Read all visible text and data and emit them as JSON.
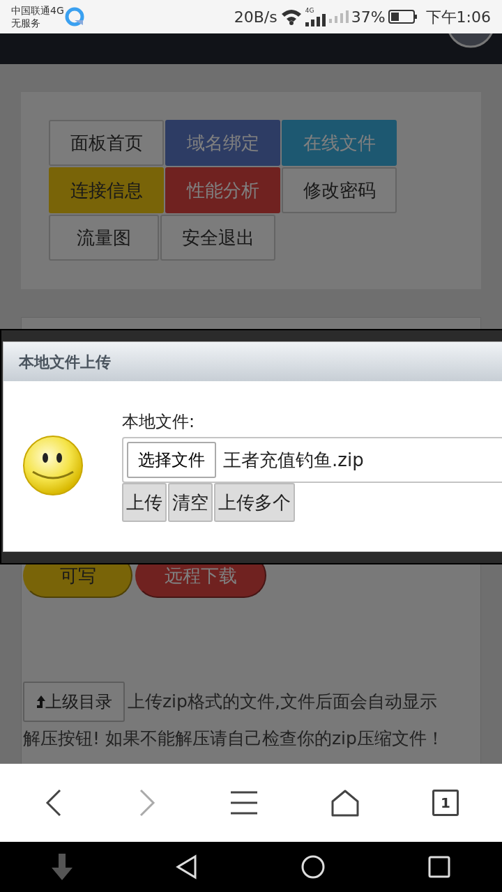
{
  "status_bar": {
    "carrier": "中国联通4G",
    "service": "无服务",
    "speed": "20B/s",
    "network": "4G",
    "battery": "37%",
    "time": "下午1:06"
  },
  "menu_buttons": [
    {
      "label": "面板首页",
      "kind": "default"
    },
    {
      "label": "域名绑定",
      "kind": "primary"
    },
    {
      "label": "在线文件",
      "kind": "info"
    },
    {
      "label": "连接信息",
      "kind": "warning"
    },
    {
      "label": "性能分析",
      "kind": "danger"
    },
    {
      "label": "修改密码",
      "kind": "default"
    },
    {
      "label": "流量图",
      "kind": "default"
    },
    {
      "label": "安全退出",
      "kind": "default"
    }
  ],
  "dialog": {
    "title": "本地文件上传",
    "field_label": "本地文件:",
    "choose_button": "选择文件",
    "file_name": "王者充值钓鱼.zip",
    "buttons": [
      "上传",
      "清空",
      "上传多个"
    ]
  },
  "actions": [
    {
      "label": "可写",
      "kind": "warning"
    },
    {
      "label": "远程下载",
      "kind": "danger"
    }
  ],
  "up_button": "上级目录",
  "note": [
    "上传zip格式的文件,文件后面会自动显示",
    "解压按钮! 如果不能解压请自己检查你的zip压缩文件！"
  ],
  "browser_bar": {
    "forward_disabled": true,
    "tab_count": "1"
  }
}
